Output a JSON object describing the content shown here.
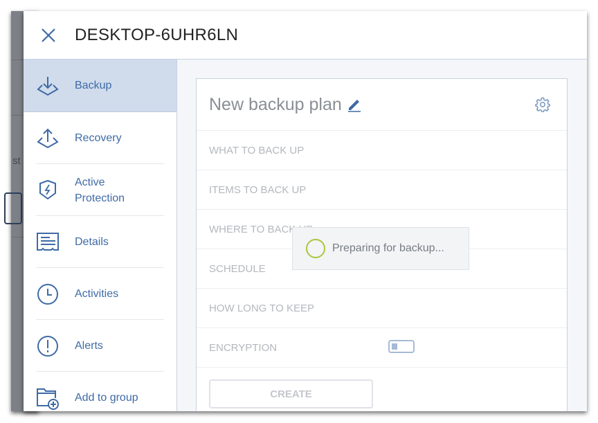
{
  "backdrop": {
    "partial_text": "st"
  },
  "header": {
    "title": "DESKTOP-6UHR6LN"
  },
  "sidebar": {
    "items": [
      {
        "label": "Backup",
        "icon": "backup-icon",
        "active": true
      },
      {
        "label": "Recovery",
        "icon": "recovery-icon"
      },
      {
        "label": "Active Protection",
        "icon": "shield-bolt-icon"
      },
      {
        "label": "Details",
        "icon": "details-icon"
      },
      {
        "label": "Activities",
        "icon": "clock-icon"
      },
      {
        "label": "Alerts",
        "icon": "alert-icon"
      },
      {
        "label": "Add to group",
        "icon": "folder-add-icon"
      }
    ]
  },
  "plan": {
    "name": "New backup plan",
    "sections": [
      "WHAT TO BACK UP",
      "ITEMS TO BACK UP",
      "WHERE TO BACK UP",
      "SCHEDULE",
      "HOW LONG TO KEEP",
      "ENCRYPTION"
    ],
    "encryption_enabled": false,
    "create_label": "CREATE"
  },
  "loading": {
    "text": "Preparing for backup..."
  },
  "colors": {
    "accent": "#3e6aa6",
    "active_bg": "#d0dcec",
    "spinner": "#a8c73c"
  }
}
